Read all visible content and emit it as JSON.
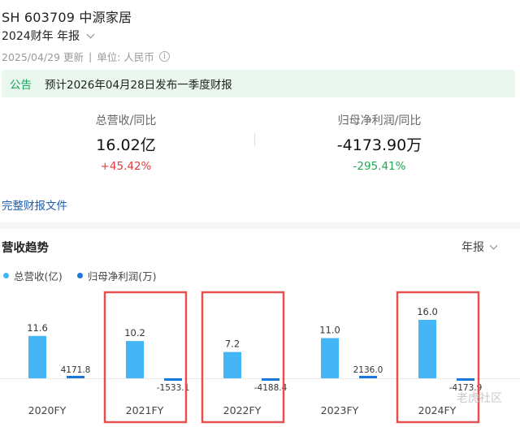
{
  "header": {
    "stock_title": "SH 603709 中源家居",
    "period_label": "2024财年 年报",
    "update_date": "2025/04/29 更新",
    "unit_label": "单位: 人民币"
  },
  "notice": {
    "tag": "公告",
    "text": "预计2026年04月28日发布一季度财报"
  },
  "metrics": [
    {
      "label": "总营收/同比",
      "value": "16.02亿",
      "change": "+45.42%"
    },
    {
      "label": "归母净利润/同比",
      "value": "-4173.90万",
      "change": "-295.41%"
    }
  ],
  "report_link": "完整财报文件",
  "trend": {
    "title": "营收趋势",
    "period_select": "年报"
  },
  "colors": {
    "revenue": "#45b6f5",
    "profit": "#1a78d8",
    "up": "#e5393b",
    "down": "#1fa952",
    "highlight": "#e55050"
  },
  "watermark": "老虎社区",
  "chart_data": {
    "type": "bar",
    "categories": [
      "2020FY",
      "2021FY",
      "2022FY",
      "2023FY",
      "2024FY"
    ],
    "series": [
      {
        "name": "总营收(亿)",
        "values": [
          11.6,
          10.2,
          7.2,
          11.0,
          16.0
        ],
        "labels": [
          "11.6",
          "10.2",
          "7.2",
          "11.0",
          "16.0"
        ]
      },
      {
        "name": "归母净利润(万)",
        "values": [
          4171.8,
          -1533.1,
          -4188.4,
          2136.0,
          -4173.9
        ],
        "labels": [
          "4171.8",
          "-1533.1",
          "-4188.4",
          "2136.0",
          "-4173.9"
        ]
      }
    ],
    "highlighted_categories": [
      "2021FY",
      "2022FY",
      "2024FY"
    ]
  }
}
